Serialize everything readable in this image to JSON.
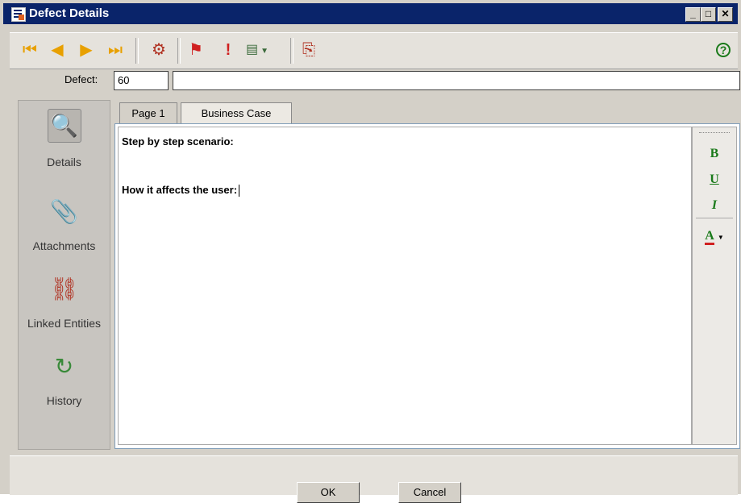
{
  "window": {
    "title": "Defect Details",
    "controls": {
      "minimize": "_",
      "restore": "□",
      "close": "✕"
    }
  },
  "toolbar": {
    "buttons": [
      {
        "name": "first-record",
        "icon": "first-icon",
        "glyph": "⏮"
      },
      {
        "name": "previous-record",
        "icon": "previous-icon",
        "glyph": "◀"
      },
      {
        "name": "next-record",
        "icon": "next-icon",
        "glyph": "▶"
      },
      {
        "name": "last-record",
        "icon": "last-icon",
        "glyph": "⏭"
      },
      {
        "name": "defect-action",
        "icon": "defect-icon",
        "glyph": "⚙"
      },
      {
        "name": "flag-follow-up",
        "icon": "flag-icon",
        "glyph": "⚑"
      },
      {
        "name": "mark-important",
        "icon": "exclamation-icon",
        "glyph": "!"
      },
      {
        "name": "view-options",
        "icon": "view-icon",
        "glyph": "▤"
      },
      {
        "name": "send-defect",
        "icon": "send-icon",
        "glyph": "⎘"
      }
    ],
    "help_glyph": "?"
  },
  "defect": {
    "label": "Defect:",
    "id": "60",
    "summary": ""
  },
  "sidebar": {
    "items": [
      {
        "label": "Details",
        "icon": "details-icon",
        "glyph": "🔍"
      },
      {
        "label": "Attachments",
        "icon": "paperclip-icon",
        "glyph": "📎"
      },
      {
        "label": "Linked Entities",
        "icon": "link-icon",
        "glyph": "⛓"
      },
      {
        "label": "History",
        "icon": "history-icon",
        "glyph": "↻"
      }
    ]
  },
  "tabs": [
    {
      "label": "Page 1"
    },
    {
      "label": "Business Case"
    }
  ],
  "editor": {
    "line1": "Step by step scenario:",
    "line2": "How it affects the user:"
  },
  "format_bar": {
    "bold": "B",
    "underline": "U",
    "italic": "I",
    "font_color": "A"
  },
  "dialog_buttons": {
    "ok": "OK",
    "cancel": "Cancel"
  },
  "colors": {
    "title_bar": "#0a246a",
    "accent_green": "#1a7a1a"
  }
}
